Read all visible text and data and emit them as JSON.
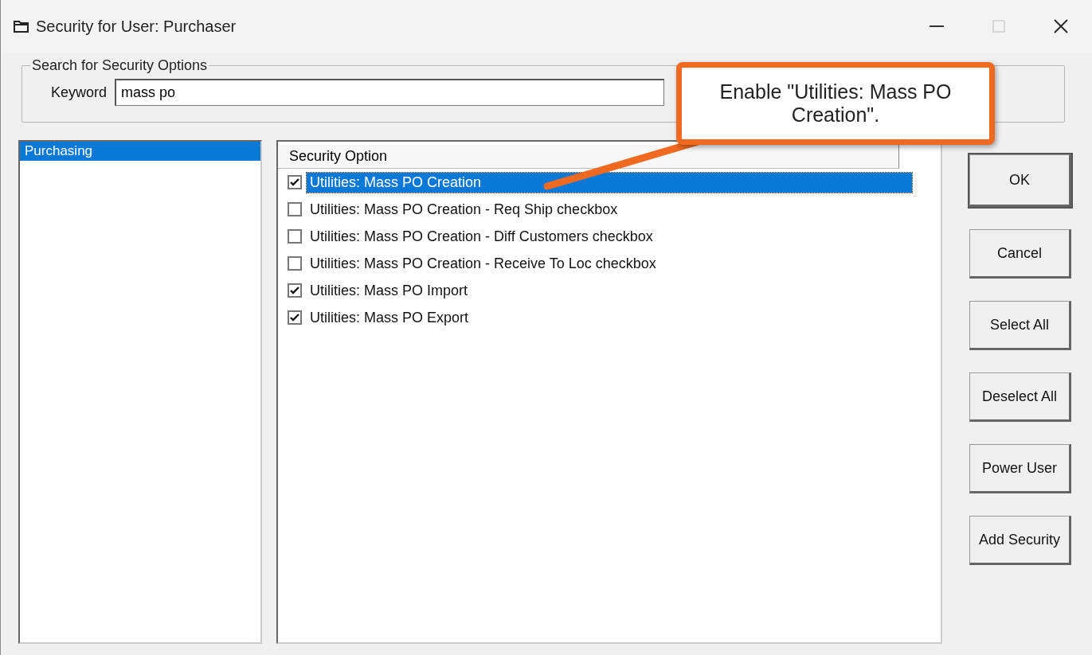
{
  "window": {
    "title": "Security for User: Purchaser"
  },
  "search": {
    "legend": "Search for Security Options",
    "label": "Keyword",
    "value": "mass po"
  },
  "modules": [
    {
      "label": "Purchasing",
      "selected": true
    }
  ],
  "options_list": {
    "column": "Security Option",
    "rows": [
      {
        "label": "Utilities: Mass PO Creation",
        "checked": true,
        "selected": true
      },
      {
        "label": "Utilities: Mass PO Creation - Req Ship checkbox",
        "checked": false,
        "selected": false
      },
      {
        "label": "Utilities: Mass PO Creation - Diff Customers checkbox",
        "checked": false,
        "selected": false
      },
      {
        "label": "Utilities: Mass PO Creation - Receive To Loc checkbox",
        "checked": false,
        "selected": false
      },
      {
        "label": "Utilities: Mass PO Import",
        "checked": true,
        "selected": false
      },
      {
        "label": "Utilities: Mass PO Export",
        "checked": true,
        "selected": false
      }
    ]
  },
  "buttons": [
    {
      "label": "OK",
      "default": true
    },
    {
      "label": "Cancel",
      "default": false
    },
    {
      "label": "Select All",
      "default": false
    },
    {
      "label": "Deselect All",
      "default": false
    },
    {
      "label": "Power User",
      "default": false
    },
    {
      "label": "Add Security",
      "default": false
    }
  ],
  "callout": {
    "text": "Enable \"Utilities: Mass PO Creation\"."
  }
}
